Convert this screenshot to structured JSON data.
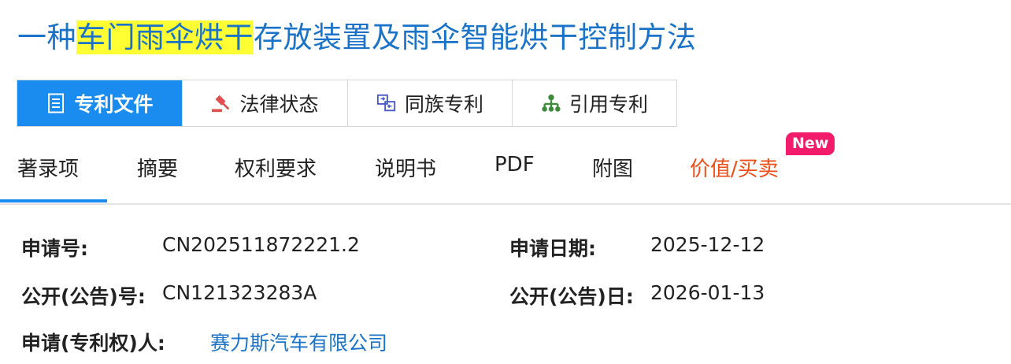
{
  "title": {
    "prefix": "一种",
    "highlight": "车门雨伞烘干",
    "suffix": "存放装置及雨伞智能烘干控制方法"
  },
  "main_tabs": [
    {
      "label": "专利文件",
      "icon": "document-icon",
      "active": true
    },
    {
      "label": "法律状态",
      "icon": "gavel-icon",
      "active": false
    },
    {
      "label": "同族专利",
      "icon": "family-swap-icon",
      "active": false
    },
    {
      "label": "引用专利",
      "icon": "hierarchy-icon",
      "active": false
    }
  ],
  "sub_tabs": [
    {
      "label": "著录项",
      "active": true
    },
    {
      "label": "摘要"
    },
    {
      "label": "权利要求"
    },
    {
      "label": "说明书"
    },
    {
      "label": "PDF"
    },
    {
      "label": "附图"
    },
    {
      "label": "价值/买卖",
      "badge": "New"
    }
  ],
  "fields": {
    "app_no_label": "申请号:",
    "app_no": "CN202511872221.2",
    "app_date_label": "申请日期:",
    "app_date": "2025-12-12",
    "pub_no_label": "公开(公告)号:",
    "pub_no": "CN121323283A",
    "pub_date_label": "公开(公告)日:",
    "pub_date": "2026-01-13",
    "applicant_label": "申请(专利权)人:",
    "applicant": "赛力斯汽车有限公司"
  },
  "colors": {
    "accent": "#1a8cf0",
    "title": "#1a73c8",
    "highlight": "#ffff33",
    "special_tab": "#f04c15",
    "badge": "#f21c6b"
  }
}
